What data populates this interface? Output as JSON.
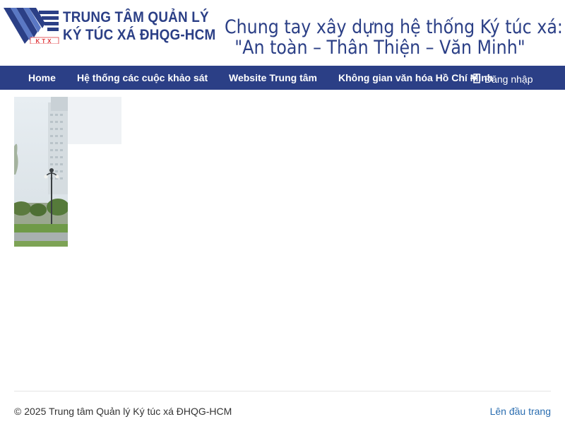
{
  "header": {
    "logo_badge": "KTX",
    "org_name_line1": "TRUNG TÂM QUẢN LÝ",
    "org_name_line2": "KÝ TÚC XÁ ĐHQG-HCM",
    "slogan_line1": "Chung tay xây dựng hệ thống Ký túc xá:",
    "slogan_line2": "\"An toàn – Thân Thiện – Văn Minh\""
  },
  "nav": {
    "items": [
      {
        "label": "Home"
      },
      {
        "label": "Hệ thống các cuộc khảo sát"
      },
      {
        "label": "Website Trung tâm"
      },
      {
        "label": "Không gian văn hóa Hồ Chí Minh"
      }
    ],
    "login_label": "Đăng nhập",
    "login_icon": "login-icon"
  },
  "footer": {
    "copyright": "© 2025 Trung tâm Quản lý Ký túc xá ĐHQG-HCM",
    "to_top": "Lên đầu trang"
  },
  "colors": {
    "brand": "#2b3f86",
    "link": "#2a6db0",
    "logo_accent": "#e03a3e"
  }
}
